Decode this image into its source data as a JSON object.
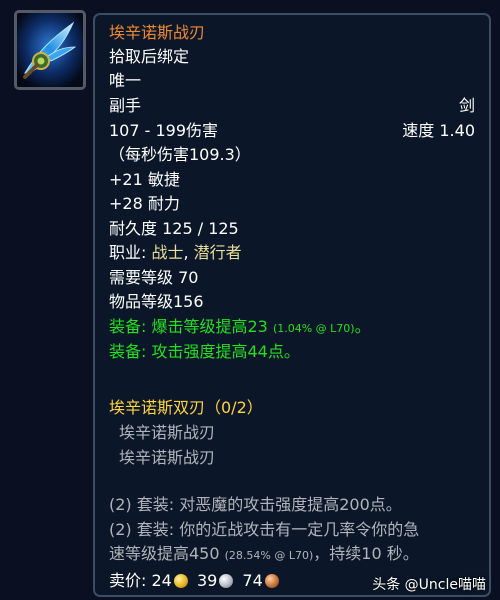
{
  "icon": {
    "name": "warglaive-of-azzinoth-icon"
  },
  "item": {
    "name": "埃辛诺斯战刃",
    "bind": "拾取后绑定",
    "unique": "唯一",
    "slot": "副手",
    "type": "剑",
    "damage": "107 - 199伤害",
    "speed": "速度 1.40",
    "dps": "（每秒伤害109.3）",
    "stat_agility": "+21 敏捷",
    "stat_stamina": "+28 耐力",
    "durability": "耐久度 125 / 125",
    "class_label": "职业: ",
    "class_warrior": "战士",
    "class_sep": ", ",
    "class_rogue": "潜行者",
    "req_level": "需要等级 70",
    "item_level": "物品等级156",
    "equip1_label": "装备: ",
    "equip1_text": "爆击等级提高23",
    "equip1_detail": "(1.04% @ L70)",
    "equip1_end": "。",
    "equip2_label": "装备: ",
    "equip2_text": "攻击强度提高44点。"
  },
  "set": {
    "title": "埃辛诺斯双刃（0/2）",
    "pieces": [
      "埃辛诺斯战刃",
      "埃辛诺斯战刃"
    ],
    "bonus1": "(2) 套装: 对恶魔的攻击强度提高200点。",
    "bonus2_line1": "(2) 套装: 你的近战攻击有一定几率令你的急",
    "bonus2_line2a": "速等级提高450",
    "bonus2_detail": "(28.54% @ L70)",
    "bonus2_line2b": "，持续10 秒。"
  },
  "sell": {
    "label": "卖价: ",
    "gold": "24",
    "silver": "39",
    "copper": "74"
  },
  "watermark": "头条 @Uncle喵喵",
  "colors": {
    "name": "#f08832",
    "equip": "#22e01e",
    "set_title": "#ffd33b",
    "set_inactive": "#b0b4ba",
    "class": "#e9dd9a"
  }
}
